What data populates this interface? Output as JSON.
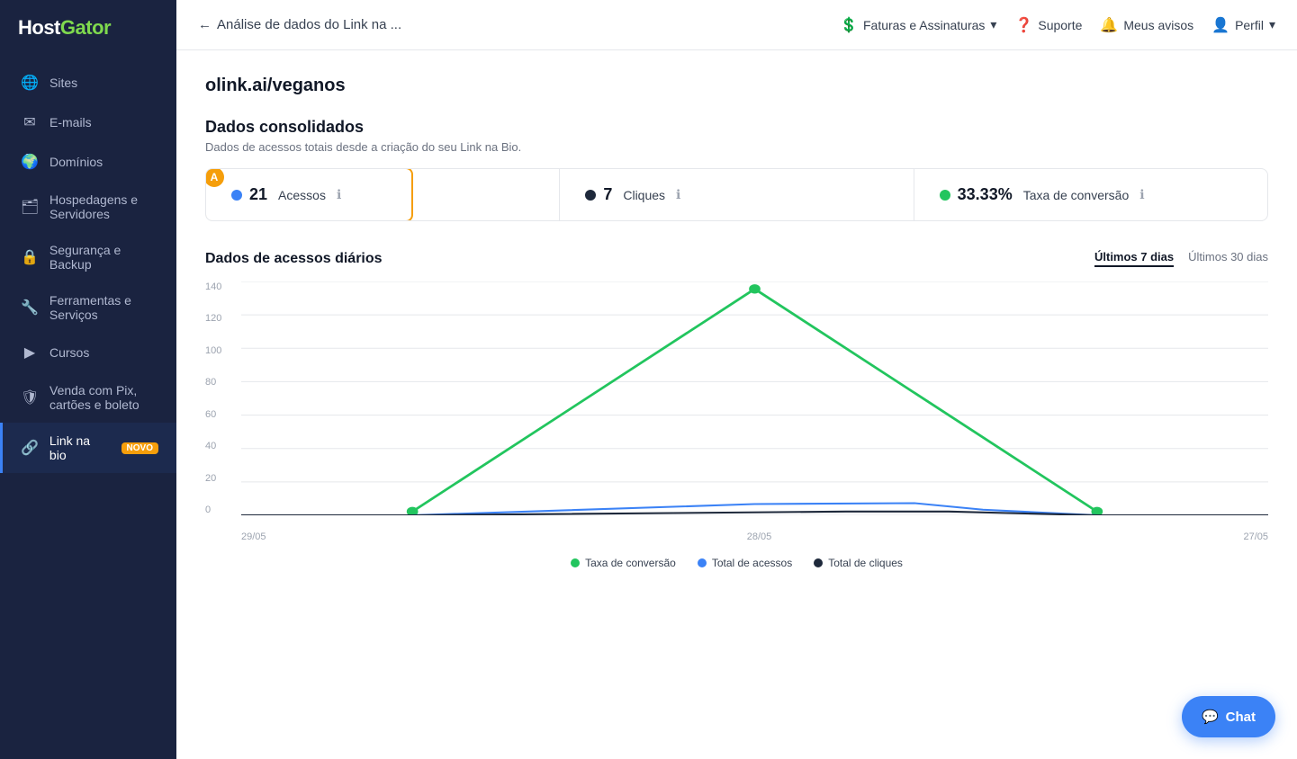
{
  "brand": {
    "name_part1": "Host",
    "name_part2": "Gator"
  },
  "sidebar": {
    "items": [
      {
        "id": "sites",
        "label": "Sites",
        "icon": "🌐",
        "active": false
      },
      {
        "id": "emails",
        "label": "E-mails",
        "icon": "✉",
        "active": false
      },
      {
        "id": "dominios",
        "label": "Domínios",
        "icon": "🌍",
        "active": false
      },
      {
        "id": "hospedagens",
        "label": "Hospedagens e Servidores",
        "icon": "🗂",
        "active": false
      },
      {
        "id": "seguranca",
        "label": "Segurança e Backup",
        "icon": "🔒",
        "active": false
      },
      {
        "id": "ferramentas",
        "label": "Ferramentas e Serviços",
        "icon": "🔧",
        "active": false
      },
      {
        "id": "cursos",
        "label": "Cursos",
        "icon": "▶",
        "active": false
      },
      {
        "id": "venda",
        "label": "Venda com Pix, cartões e boleto",
        "icon": "🛡",
        "active": false
      },
      {
        "id": "link-bio",
        "label": "Link na bio",
        "icon": "🔗",
        "active": true,
        "badge": "NOVO"
      }
    ]
  },
  "topnav": {
    "back_label": "←",
    "title": "Análise de dados do Link na ...",
    "faturas_label": "Faturas e Assinaturas",
    "suporte_label": "Suporte",
    "avisos_label": "Meus avisos",
    "perfil_label": "Perfil"
  },
  "page": {
    "url": "olink.ai/veganos",
    "consolidated_title": "Dados consolidados",
    "consolidated_sub": "Dados de acessos totais desde a criação do seu Link na Bio.",
    "stats": [
      {
        "id": "acessos",
        "dot_color": "#3b82f6",
        "value": "21",
        "label": "Acessos"
      },
      {
        "id": "cliques",
        "dot_color": "#1e293b",
        "value": "7",
        "label": "Cliques"
      },
      {
        "id": "conversao",
        "dot_color": "#22c55e",
        "value": "33.33%",
        "label": "Taxa de conversão"
      }
    ],
    "chart_title": "Dados de acessos diários",
    "chart_tabs": [
      {
        "id": "7dias",
        "label": "Últimos 7 dias",
        "active": true
      },
      {
        "id": "30dias",
        "label": "Últimos 30 dias",
        "active": false
      }
    ],
    "y_labels": [
      "140",
      "120",
      "100",
      "80",
      "60",
      "40",
      "20",
      "0"
    ],
    "x_labels": [
      "29/05",
      "28/05",
      "27/05"
    ],
    "legend": [
      {
        "id": "conversao",
        "color": "#22c55e",
        "label": "Taxa de conversão"
      },
      {
        "id": "acessos",
        "color": "#3b82f6",
        "label": "Total de acessos"
      },
      {
        "id": "cliques",
        "color": "#1e293b",
        "label": "Total de cliques"
      }
    ]
  },
  "chat": {
    "label": "Chat"
  }
}
